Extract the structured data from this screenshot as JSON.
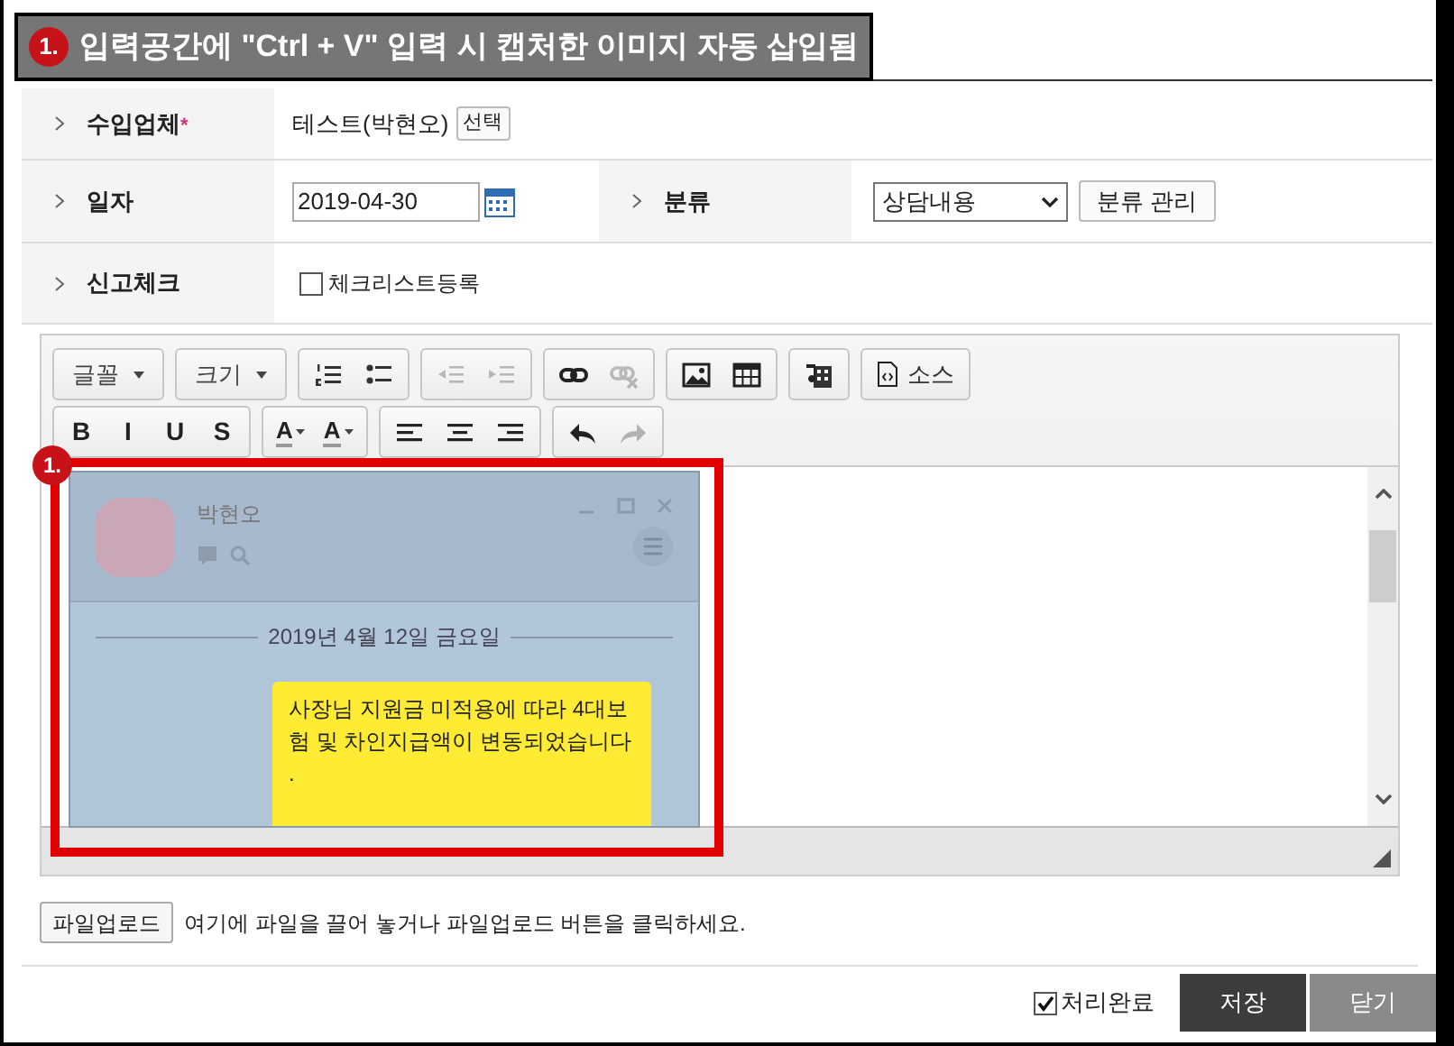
{
  "banner": {
    "number": "1.",
    "text": "입력공간에 \"Ctrl + V\" 입력 시 캡처한 이미지 자동 삽입됨"
  },
  "form": {
    "company": {
      "label": "수입업체",
      "required_mark": "*",
      "value": "테스트(박현오)",
      "button": "선택"
    },
    "date": {
      "label": "일자",
      "value": "2019-04-30"
    },
    "category": {
      "label": "분류",
      "value": "상담내용",
      "button": "분류 관리"
    },
    "report": {
      "label": "신고체크",
      "checkbox_label": "체크리스트등록",
      "checked": false
    }
  },
  "editor": {
    "toolbar": [
      [
        [
          {
            "kind": "dropdown",
            "label": "글꼴"
          }
        ],
        [
          {
            "kind": "dropdown",
            "label": "크기"
          }
        ],
        [
          {
            "kind": "icon",
            "disabled": false
          },
          {
            "kind": "icon",
            "disabled": false
          }
        ],
        [
          {
            "kind": "icon",
            "disabled": true
          },
          {
            "kind": "icon",
            "disabled": true
          }
        ],
        [
          {
            "kind": "icon",
            "disabled": false
          },
          {
            "kind": "icon",
            "disabled": true
          }
        ],
        [
          {
            "kind": "icon",
            "disabled": false
          },
          {
            "kind": "icon",
            "disabled": false
          }
        ],
        [
          {
            "kind": "icon",
            "disabled": false
          }
        ],
        [
          {
            "kind": "source",
            "label": "소스"
          }
        ]
      ],
      [
        [
          {
            "kind": "format",
            "label": "B"
          },
          {
            "kind": "format",
            "label": "I"
          },
          {
            "kind": "format",
            "label": "U"
          },
          {
            "kind": "format",
            "label": "S"
          }
        ],
        [
          {
            "kind": "color",
            "label": "A"
          },
          {
            "kind": "color",
            "label": "A"
          }
        ],
        [
          {
            "kind": "icon",
            "disabled": false
          },
          {
            "kind": "icon",
            "disabled": false
          },
          {
            "kind": "icon",
            "disabled": false
          }
        ],
        [
          {
            "kind": "icon",
            "disabled": false
          },
          {
            "kind": "icon",
            "disabled": true
          }
        ]
      ]
    ],
    "annotation_number": "1.",
    "pasted_chat": {
      "name": "박현오",
      "date": "2019년 4월 12일 금요일",
      "message": "사장님 지원금 미적용에 따라 4대보험 및 차인지급액이 변동되었습니다",
      "message_tail": "."
    }
  },
  "upload": {
    "button": "파일업로드",
    "hint": "여기에 파일을 끌어 놓거나 파일업로드 버튼을 클릭하세요."
  },
  "footer": {
    "done": {
      "label": "처리완료",
      "checked": true
    },
    "buttons": [
      {
        "kind": "primary",
        "label": "저장"
      },
      {
        "kind": "secondary",
        "label": "닫기"
      }
    ]
  }
}
